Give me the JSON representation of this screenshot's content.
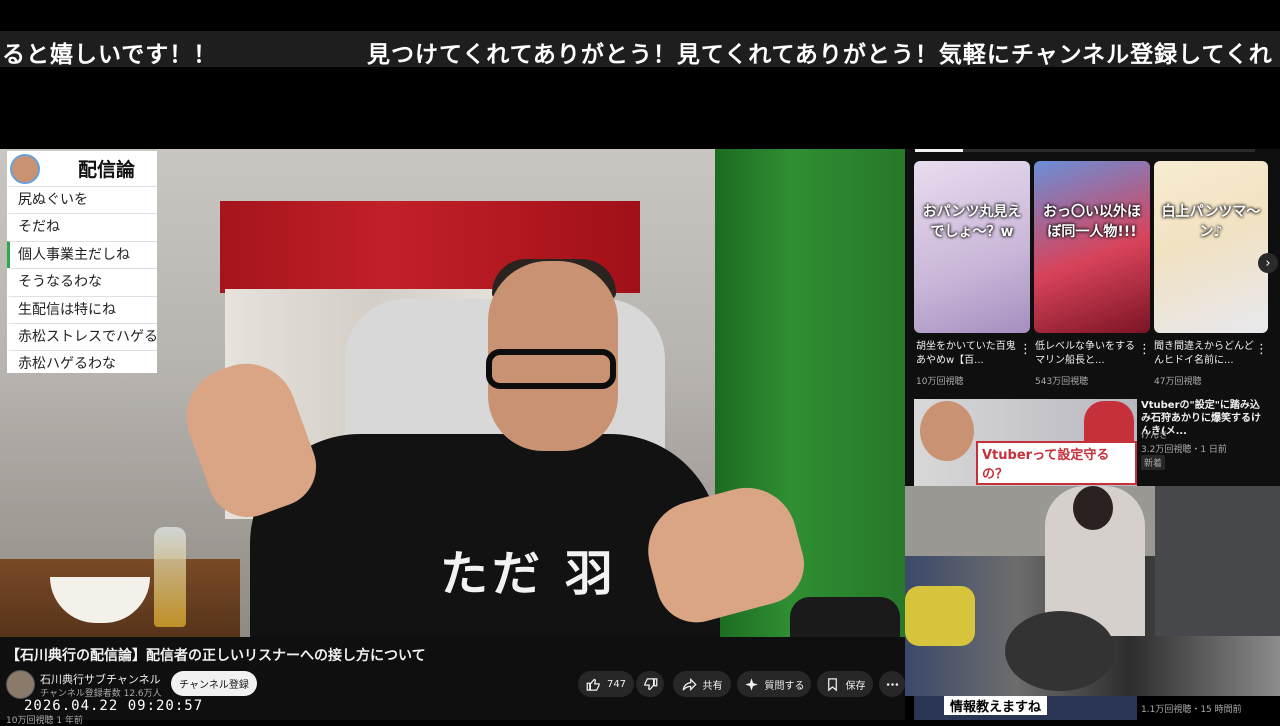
{
  "ticker": {
    "segment_a": "ると嬉しいです！！",
    "segment_b": "見つけてくれてありがとう！見てくれてありがとう！気軽にチャンネル登録してくれ"
  },
  "chat": {
    "title": "配信論",
    "messages": [
      "尻ぬぐいを",
      "そだね",
      "個人事業主だしね",
      "そうなるわな",
      "生配信は特にね",
      "赤松ストレスでハゲる",
      "赤松ハゲるわな"
    ]
  },
  "video": {
    "shirt_text": "ただ 羽",
    "title": "【石川典行の配信論】配信者の正しいリスナーへの接し方について",
    "channel_name": "石川典行サブチャンネル",
    "subscribers": "チャンネル登録者数 12.6万人",
    "subscribe_label": "チャンネル登録",
    "like_count": "747",
    "share_label": "共有",
    "ask_label": "質問する",
    "save_label": "保存",
    "datetime": "2026.04.22 09:20:57",
    "views_partial": "10万回視聴 1 年前"
  },
  "shorts": [
    {
      "caption": "おパンツ丸見えでしょ〜？w",
      "title": "胡坐をかいていた百鬼あやめw【百...",
      "views": "10万回視聴",
      "color": "#c9b6d8"
    },
    {
      "caption": "おっ〇い以外ほぼ同一人物!!!",
      "title": "低レベルな争いをするマリン船長と...",
      "views": "543万回視聴",
      "color": "#d8435a"
    },
    {
      "caption": "白上パンツマ〜ン♪",
      "title": "聞き間違えからどんどんヒドイ名前に...",
      "views": "47万回視聴",
      "color": "#f1e2c2"
    }
  ],
  "recommended": [
    {
      "title": "Vtuberの\"設定\"に踏み込み石狩あかりに爆笑するけんき(メ...",
      "channel": "けんき",
      "meta": "3.2万回視聴・1 日前",
      "badge": "新着",
      "thumb_text": "Vtuberって設定守るの？"
    },
    {
      "title": "",
      "channel": "",
      "meta": "1.1万回視聴・15 時間前",
      "badge": "",
      "thumb_text": "情報教えますね"
    }
  ],
  "icons": {
    "like": "thumbs-up-icon",
    "dislike": "thumbs-down-icon",
    "share": "share-icon",
    "ask": "sparkle-icon",
    "save": "bookmark-icon",
    "more": "more-icon",
    "next": "chevron-right-icon"
  },
  "colors": {
    "bg": "#0f0f0f",
    "chip": "#272727",
    "text": "#f1f1f1",
    "muted": "#aaaaaa",
    "chat_highlight": "#2ea84a"
  }
}
